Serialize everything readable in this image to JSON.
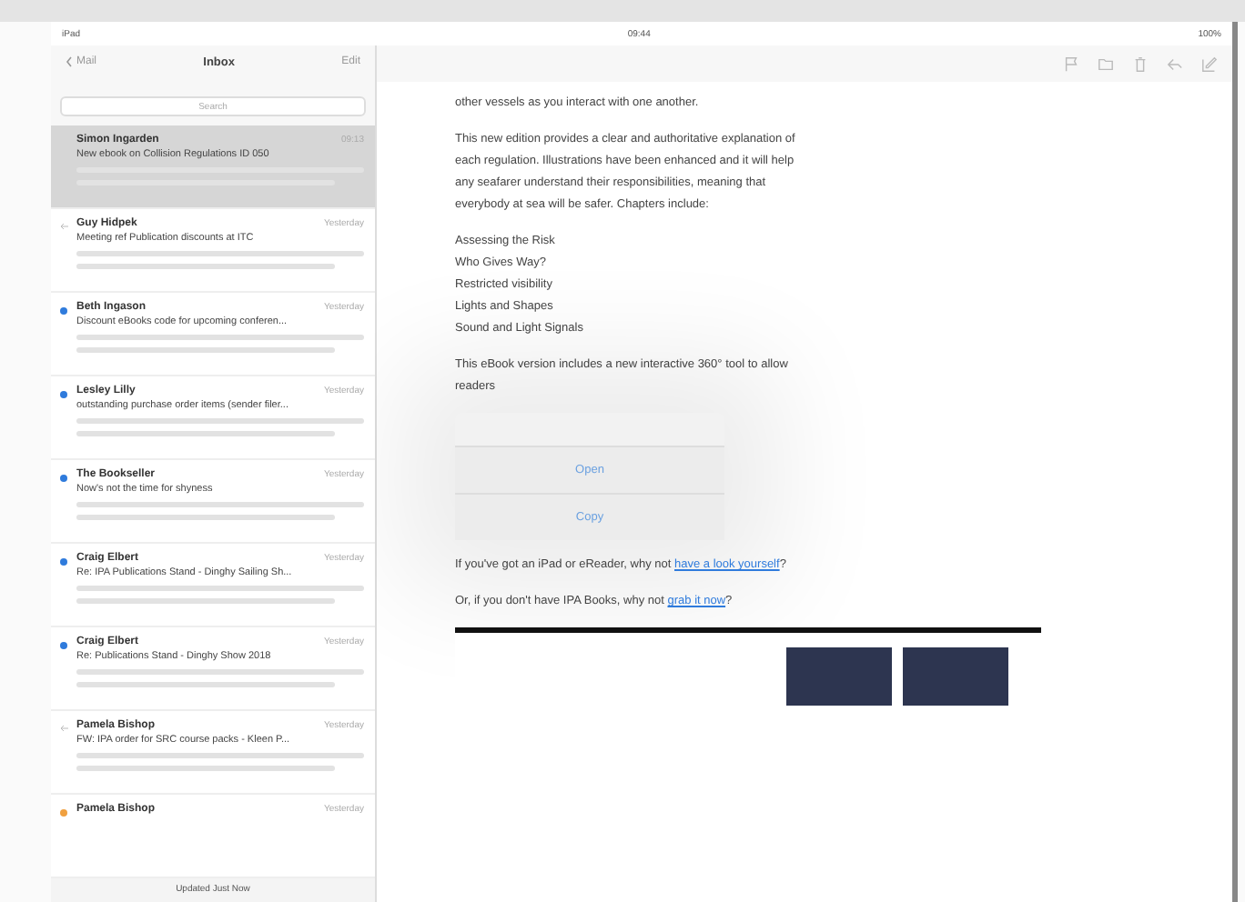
{
  "status_bar": {
    "device": "iPad",
    "time": "09:44",
    "battery": "100%"
  },
  "mail_list": {
    "back": "Mail",
    "title": "Inbox",
    "edit": "Edit",
    "search": {
      "placeholder": "Search"
    },
    "messages": [
      {
        "sender": "Simon Ingarden",
        "date": "09:13",
        "subject": "New ebook on Collision Regulations ID 050",
        "selected": true,
        "replied": false
      },
      {
        "sender": "Guy Hidpek",
        "date": "Yesterday",
        "subject": "Meeting ref Publication discounts at ITC",
        "selected": false,
        "replied": true
      },
      {
        "sender": "Beth Ingason",
        "date": "Yesterday",
        "subject": "Discount eBooks code for upcoming conferen...",
        "selected": false,
        "replied": false,
        "color": "#2f7bdc"
      },
      {
        "sender": "Lesley Lilly",
        "date": "Yesterday",
        "subject": "outstanding purchase order items (sender filer...",
        "selected": false,
        "replied": false,
        "color": "#2f7bdc"
      },
      {
        "sender": "The Bookseller",
        "date": "Yesterday",
        "subject": "Now's not the time for shyness",
        "selected": false,
        "replied": false,
        "color": "#2f7bdc"
      },
      {
        "sender": "Craig Elbert",
        "date": "Yesterday",
        "subject": "Re: IPA Publications Stand - Dinghy Sailing Sh...",
        "selected": false,
        "replied": false,
        "color": "#2f7bdc"
      },
      {
        "sender": "Craig Elbert",
        "date": "Yesterday",
        "subject": "Re: Publications Stand - Dinghy Show 2018",
        "selected": false,
        "replied": false,
        "color": "#2f7bdc"
      },
      {
        "sender": "Pamela Bishop",
        "date": "Yesterday",
        "subject": "FW: IPA order for SRC course packs - Kleen P...",
        "selected": false,
        "replied": true
      },
      {
        "sender": "Pamela Bishop",
        "date": "Yesterday",
        "selected": false,
        "replied": false,
        "color": "#f0a040"
      }
    ],
    "footer": "Updated Just Now"
  },
  "message": {
    "paragraphs_before": [
      "other vessels as you interact with one another.",
      "This new edition provides a clear and authoritative explanation of each regulation. Illustrations have been enhanced and it will help any seafarer understand their responsibilities, meaning that everybody at sea will be safer. Chapters include:"
    ],
    "chapters": [
      "Assessing the Risk",
      "Who Gives Way?",
      "Restricted visibility",
      "Lights and Shapes",
      "Sound and Light Signals"
    ],
    "paragraph_before_popup": "This eBook version includes a new interactive 360° tool to allow readers",
    "popup": {
      "actions": [
        "Open",
        "Copy"
      ]
    },
    "link_paragraphs": [
      {
        "text": "If you've got an iPad or eReader, why not",
        "link": "have a look yourself",
        "end": "?"
      },
      {
        "text": "Or, if you don't have IPA Books, why not",
        "link": "grab it now",
        "end": "?"
      }
    ]
  }
}
